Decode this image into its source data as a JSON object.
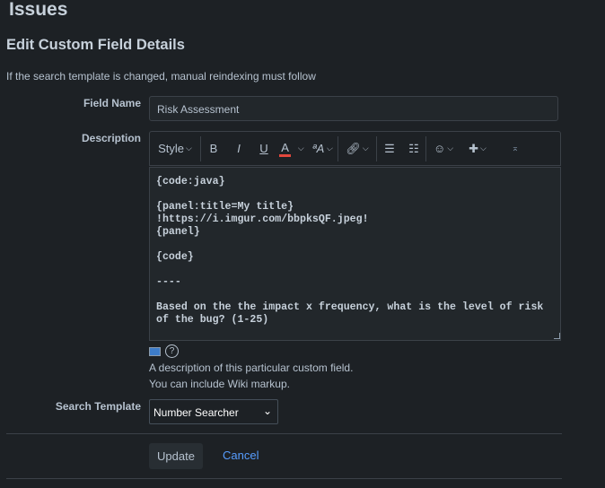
{
  "header": {
    "title": "Issues",
    "subtitle": "Edit Custom Field Details",
    "note": "If the search template is changed, manual reindexing must follow"
  },
  "field_name": {
    "label": "Field Name",
    "value": "Risk Assessment"
  },
  "description": {
    "label": "Description",
    "toolbar": {
      "style": "Style",
      "bold": "B",
      "italic": "I",
      "underline": "U",
      "text_color": "A",
      "text_color_accent": "#e2483d",
      "text_size": "ªA"
    },
    "lines": [
      "{code:java}",
      "",
      "{panel:title=My title}",
      "!https://i.imgur.com/bbpksQF.jpeg!",
      "{panel}",
      "",
      "{code}",
      "",
      "----",
      "",
      "Based on the the impact x frequency, what is the level of risk",
      "of the bug? (1-25)"
    ],
    "help1": "A description of this particular custom field.",
    "help2": "You can include Wiki markup."
  },
  "search_template": {
    "label": "Search Template",
    "value": "Number Searcher"
  },
  "actions": {
    "update": "Update",
    "cancel": "Cancel"
  }
}
